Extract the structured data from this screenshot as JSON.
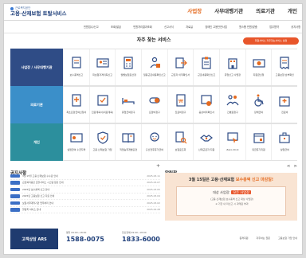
{
  "header": {
    "org": "근로복지공단",
    "title": "고용·산재보험 토탈서비스",
    "nav": [
      "사업장",
      "사무대행기관",
      "의료기관",
      "개인"
    ],
    "active_nav": 0
  },
  "submenu": [
    "민원접수/신고",
    "조회/발급",
    "민원처리결과조회",
    "신고서식",
    "자료실",
    "장애인 고용안전사업",
    "원스톱 민원/맞춤",
    "업무협약",
    "공지사항"
  ],
  "services": {
    "title": "자주 찾는 서비스",
    "favorite_button": "회원서비스 자주찾는서비스 설정",
    "rows": [
      {
        "label": "사업장 / 사무대행기관",
        "color": "#2f4c86",
        "items": [
          "보수총액신고",
          "피보험자격취득신고",
          "월별보험료산정",
          "일용근로내용확인신고",
          "근로자 이직확인서",
          "근로내용확인신고",
          "휴업신고 사업장",
          "지원금신청",
          "고용보험 납부확인"
        ]
      },
      {
        "label": "의료기관",
        "color": "#3b8fc9",
        "items": [
          "최초요양급여신청서",
          "진료계획서(의료계획)",
          "휴업급여청구",
          "요양비청구",
          "진료비청구",
          "공상처리확인서",
          "간병료청구",
          "장해급여",
          "진료비"
        ]
      },
      {
        "label": "개인",
        "color": "#2c8f9d",
        "items": [
          "실업급여 수급자격",
          "고용·산재보험 가입",
          "직업능력개발훈련",
          "출산전후휴가급여",
          "보험료조회",
          "산재근로자 지원",
          "Zero-Click",
          "유급휴가지원",
          "실업급여"
        ]
      }
    ]
  },
  "notice": {
    "title": "공지사항",
    "more": "+",
    "items": [
      {
        "text": "3월 15일 고용·산재보험 수수료 안내",
        "date": "2025-03-11"
      },
      {
        "text": "근로복지공단 토탈서비스 시스템 점검 안내",
        "date": "2025-03-07"
      },
      {
        "text": "2025년 보수총액 신고 안내",
        "date": "2025-03-05"
      },
      {
        "text": "2025년 고용보험 신고 자료 안내",
        "date": "2025-03-04"
      },
      {
        "text": "보험사무대행기관 업무처리 안내",
        "date": "2025-03-02"
      },
      {
        "text": "알림톡 서비스 안내",
        "date": "2025-02-28"
      }
    ]
  },
  "alarm": {
    "title": "알림창",
    "prev": "<",
    "next": ">",
    "banner_line1": "3월 15일은 고용·산재보험",
    "banner_highlight": "보수총액 신고 마감일!",
    "target_label": "대상 사업장:",
    "target_value": "모든 사업장",
    "note_line1": "(고용·산재보험 보수총액 신고 대상 사업장)",
    "note_line2": "※ 기한 내 미신고 시 과태료 부과"
  },
  "footer": {
    "ars": "고객상담 ARS",
    "phones": [
      {
        "label": "평일 09:00~18:00",
        "number": "1588-0075"
      },
      {
        "label": "전산장애 09:00~18:00",
        "number": "1833-6000"
      }
    ],
    "links": [
      "원격지원",
      "자주하는 질문",
      "고용보험 가입 안내"
    ]
  }
}
